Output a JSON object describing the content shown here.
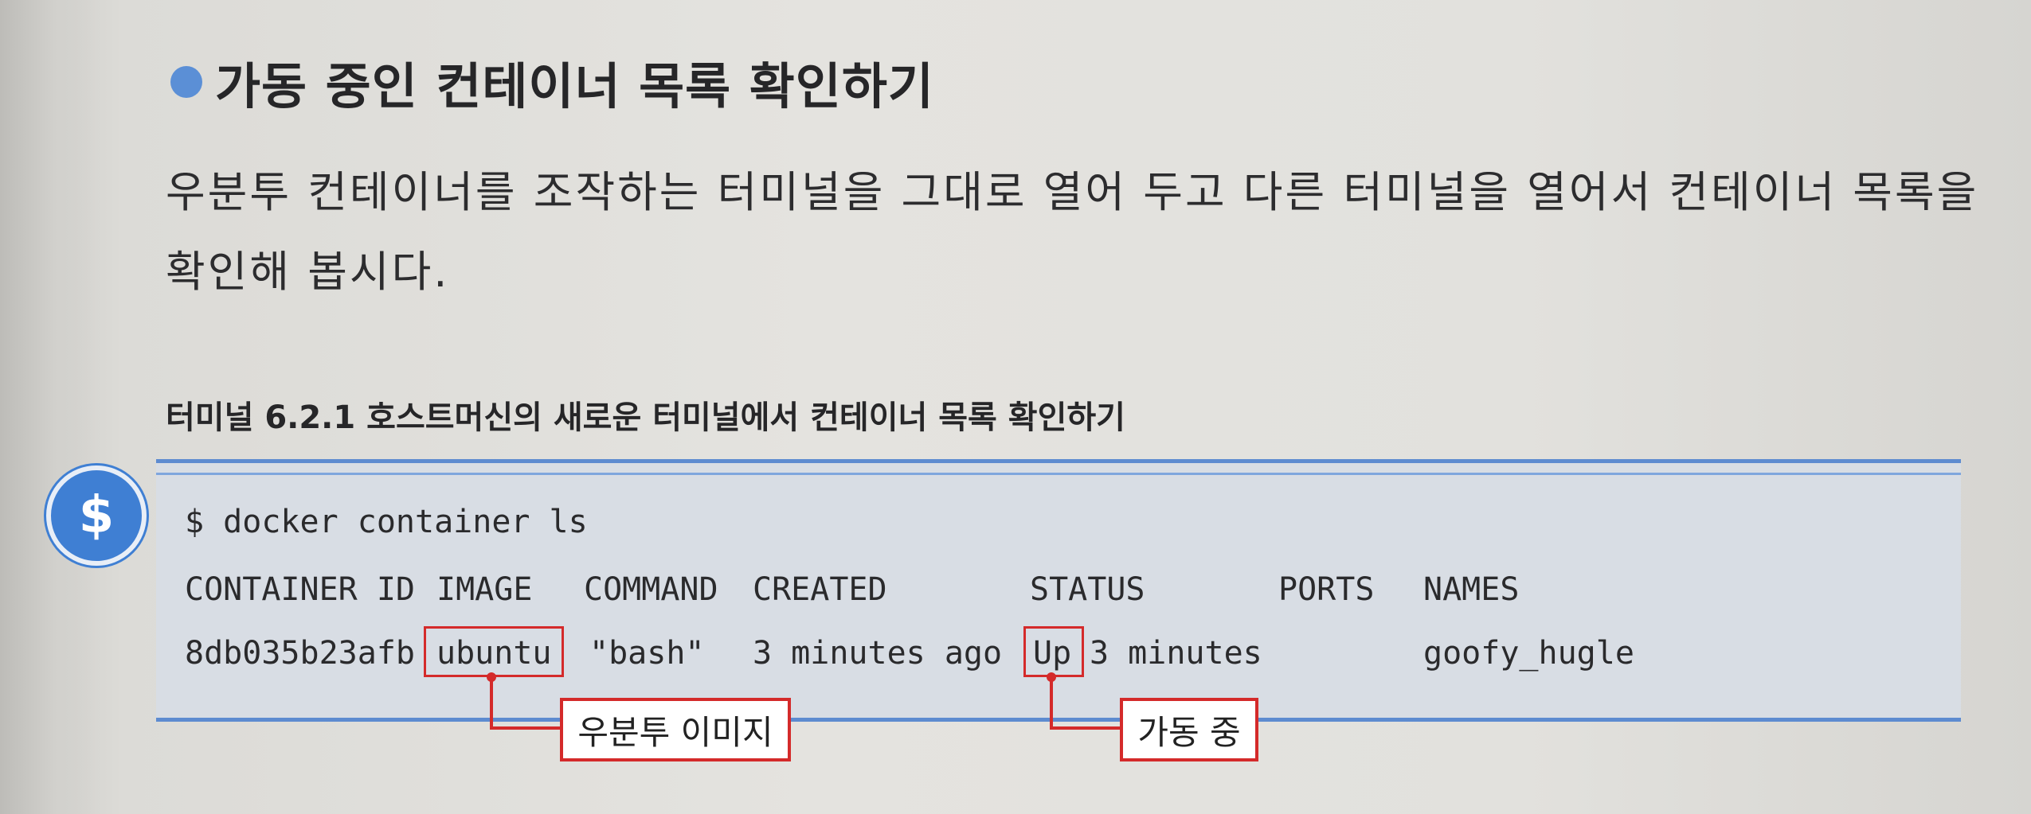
{
  "heading": "가동 중인 컨테이너 목록 확인하기",
  "paragraph": "우분투 컨테이너를 조작하는 터미널을 그대로 열어 두고 다른 터미널을 열어서 컨테이너 목록을 확인해 봅시다.",
  "figure_caption": "터미널 6.2.1 호스트머신의 새로운 터미널에서 컨테이너 목록 확인하기",
  "terminal": {
    "badge": "$",
    "command": "$ docker container ls",
    "headers": [
      "CONTAINER ID",
      "IMAGE",
      "COMMAND",
      "CREATED",
      "STATUS",
      "PORTS",
      "NAMES"
    ],
    "row": {
      "container_id": "8db035b23afb",
      "image": "ubuntu",
      "command": "\"bash\"",
      "created": "3 minutes ago",
      "status_up": "Up",
      "status_rest": "3 minutes",
      "ports": "",
      "names": "goofy_hugle"
    }
  },
  "callouts": {
    "image_label": "우분투 이미지",
    "status_label": "가동 중"
  },
  "colors": {
    "accent_blue": "#5d8bd0",
    "highlight_red": "#d42a2a",
    "terminal_bg": "#d8dde4"
  }
}
